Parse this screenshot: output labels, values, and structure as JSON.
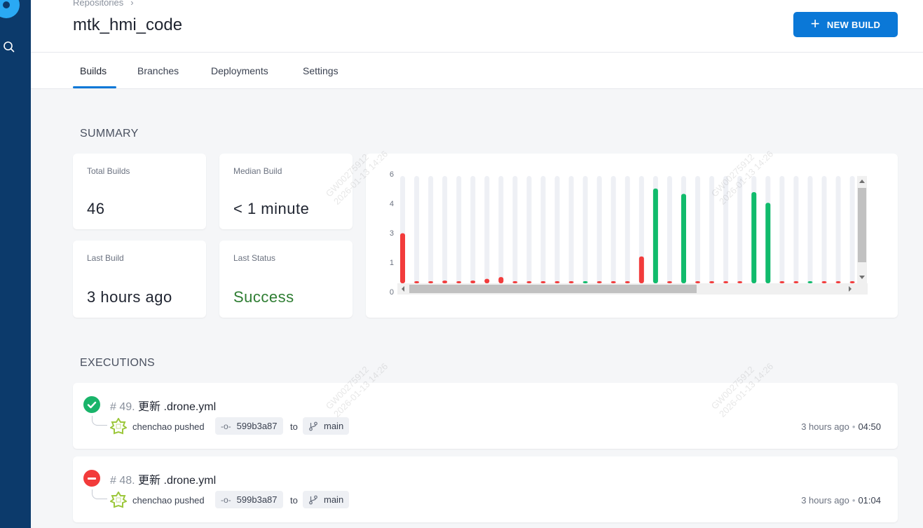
{
  "breadcrumb": {
    "label": "Repositories"
  },
  "repo": {
    "title": "mtk_hmi_code"
  },
  "actions": {
    "new_build": "NEW BUILD"
  },
  "tabs": [
    {
      "label": "Builds"
    },
    {
      "label": "Branches"
    },
    {
      "label": "Deployments"
    },
    {
      "label": "Settings"
    }
  ],
  "summary": {
    "title": "SUMMARY",
    "total_builds_label": "Total Builds",
    "total_builds": "46",
    "median_build_label": "Median Build",
    "median_build": "< 1 minute",
    "last_build_label": "Last Build",
    "last_build": "3 hours ago",
    "last_status_label": "Last Status",
    "last_status": "Success"
  },
  "chart_data": {
    "type": "bar",
    "y_ticks": [
      "6",
      "4",
      "3",
      "1",
      "0"
    ],
    "series": [
      {
        "values": [
          2.8,
          0.1,
          0.1,
          0.15,
          0.1,
          0.15,
          0.25,
          0.35,
          0.1,
          0.1,
          0.1,
          0.1,
          0.1,
          0.1,
          0.1,
          0.1,
          0.1,
          1.5,
          5.3,
          0.1,
          5.0,
          0.1,
          0.1,
          0.1,
          0.1,
          5.1,
          4.5,
          0.1,
          0.1,
          0.1,
          0.1,
          0.1,
          0.1
        ],
        "status": [
          "f",
          "f",
          "f",
          "f",
          "f",
          "f",
          "f",
          "f",
          "f",
          "f",
          "f",
          "f",
          "f",
          "s",
          "f",
          "f",
          "f",
          "f",
          "s",
          "f",
          "s",
          "f",
          "f",
          "f",
          "f",
          "s",
          "s",
          "f",
          "f",
          "s",
          "f",
          "f",
          "f"
        ]
      }
    ],
    "colors": {
      "success": "#11bb6c",
      "failure": "#f23b3b",
      "track": "#eef0f5"
    }
  },
  "executions": {
    "title": "EXECUTIONS",
    "items": [
      {
        "number": "# 49.",
        "message": "更新 .drone.yml",
        "status": "success",
        "author": "chenchao pushed",
        "commit": "599b3a87",
        "to": "to",
        "branch": "main",
        "ago": "3 hours ago",
        "sep": "•",
        "duration": "04:50"
      },
      {
        "number": "# 48.",
        "message": "更新 .drone.yml",
        "status": "failure",
        "author": "chenchao pushed",
        "commit": "599b3a87",
        "to": "to",
        "branch": "main",
        "ago": "3 hours ago",
        "sep": "•",
        "duration": "01:04"
      }
    ]
  },
  "watermark": {
    "line1": "GW00275912",
    "line2": "2026-01-13 14:26"
  }
}
